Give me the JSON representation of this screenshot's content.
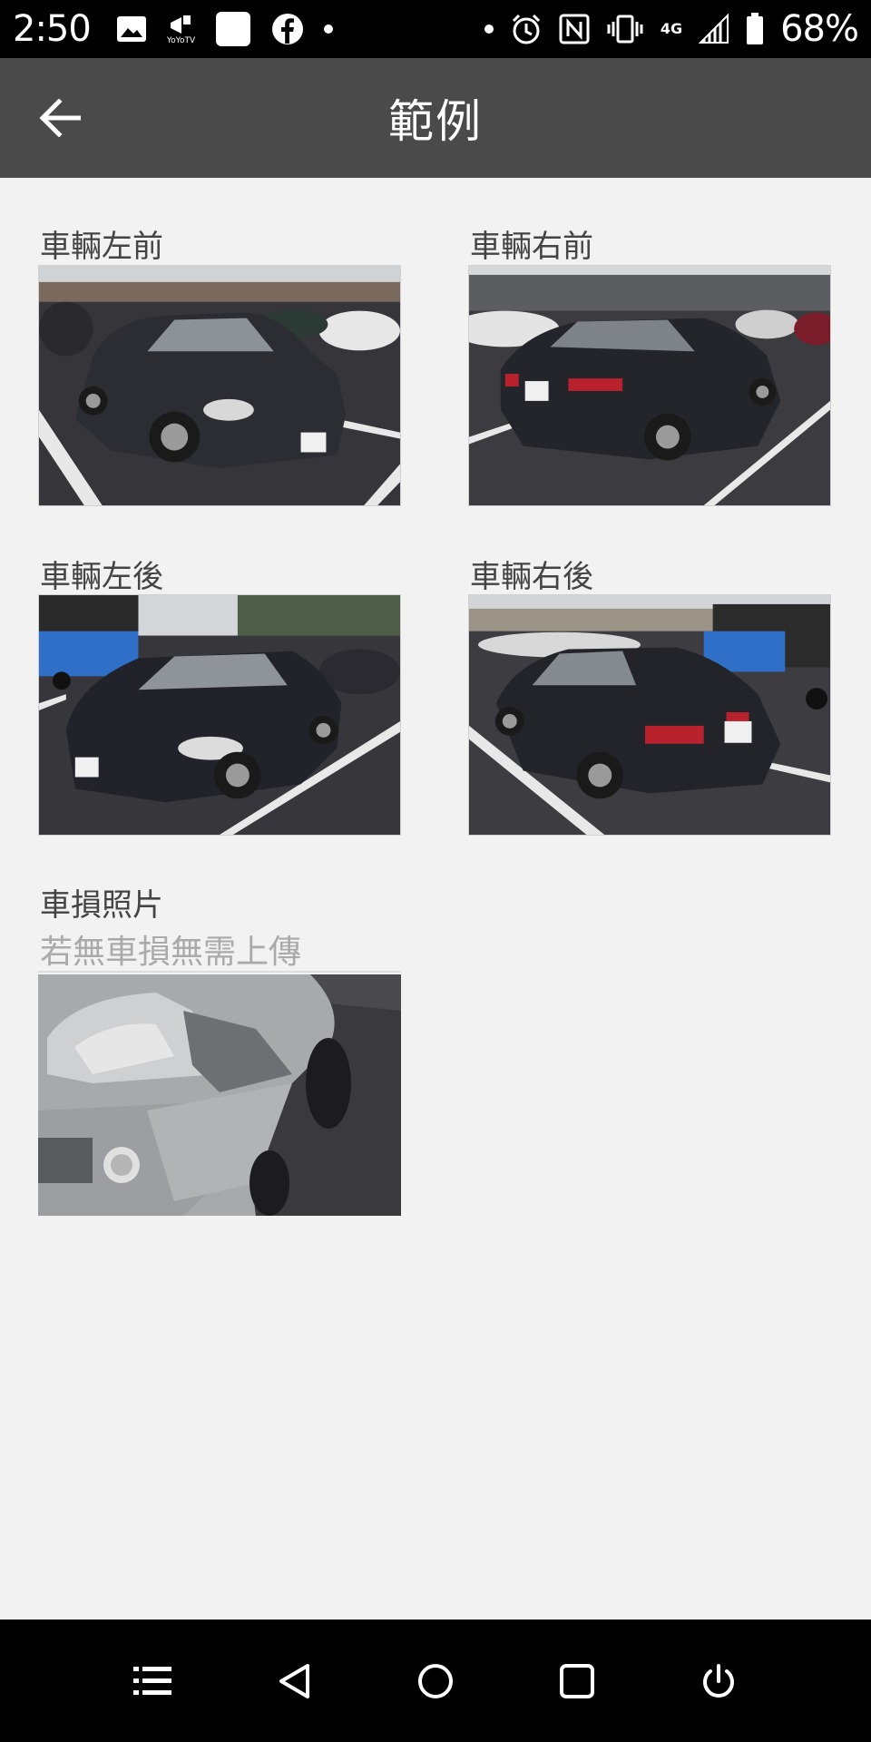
{
  "status_bar": {
    "time": "2:50",
    "yoyo_label": "YoYoTV",
    "network": "4G",
    "battery": "68%",
    "left_icons": [
      "image-icon",
      "yoyotv-icon",
      "app-square-icon",
      "facebook-icon",
      "notification-dot-icon"
    ],
    "right_icons": [
      "dot-icon",
      "alarm-icon",
      "nfc-icon",
      "vibrate-icon",
      "4g-icon",
      "signal-icon",
      "battery-icon"
    ]
  },
  "app_bar": {
    "title": "範例",
    "back_icon": "arrow-left-icon"
  },
  "examples": {
    "front_left": {
      "label": "車輛左前"
    },
    "front_right": {
      "label": "車輛右前"
    },
    "rear_left": {
      "label": "車輛左後"
    },
    "rear_right": {
      "label": "車輛右後"
    },
    "damage": {
      "label": "車損照片",
      "note": "若無車損無需上傳"
    }
  },
  "nav_bar": {
    "buttons": [
      "menu-icon",
      "back-triangle-icon",
      "home-circle-icon",
      "recents-square-icon",
      "power-icon"
    ]
  },
  "colors": {
    "app_bar": "#4a4a4a",
    "background": "#f2f2f2",
    "label_text": "#444444",
    "note_text": "#aaaaaa"
  }
}
